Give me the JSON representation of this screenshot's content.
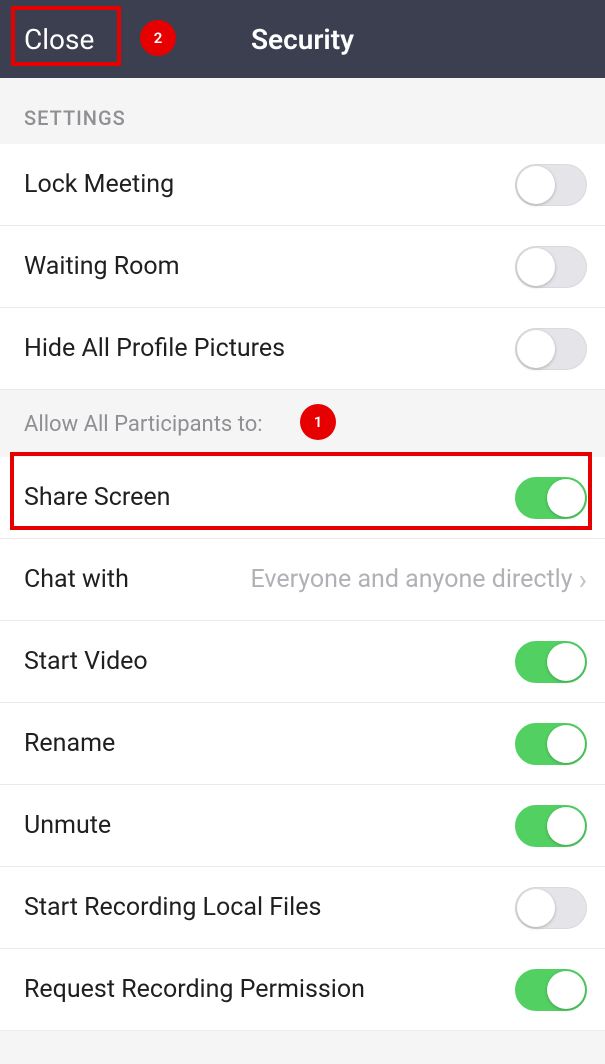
{
  "header": {
    "close_label": "Close",
    "title": "Security"
  },
  "sections": {
    "settings_header": "SETTINGS",
    "allow_header": "Allow All Participants to:"
  },
  "settings_rows": [
    {
      "label": "Lock Meeting",
      "toggle_on": false
    },
    {
      "label": "Waiting Room",
      "toggle_on": false
    },
    {
      "label": "Hide All Profile Pictures",
      "toggle_on": false
    }
  ],
  "allow_rows": [
    {
      "label": "Share Screen",
      "type": "toggle",
      "toggle_on": true
    },
    {
      "label": "Chat with",
      "type": "value",
      "value": "Everyone and anyone directly"
    },
    {
      "label": "Start Video",
      "type": "toggle",
      "toggle_on": true
    },
    {
      "label": "Rename",
      "type": "toggle",
      "toggle_on": true
    },
    {
      "label": "Unmute",
      "type": "toggle",
      "toggle_on": true
    },
    {
      "label": "Start Recording Local Files",
      "type": "toggle",
      "toggle_on": false
    },
    {
      "label": "Request Recording Permission",
      "type": "toggle",
      "toggle_on": true
    }
  ],
  "annotations": {
    "marker1": "1",
    "marker2": "2"
  }
}
